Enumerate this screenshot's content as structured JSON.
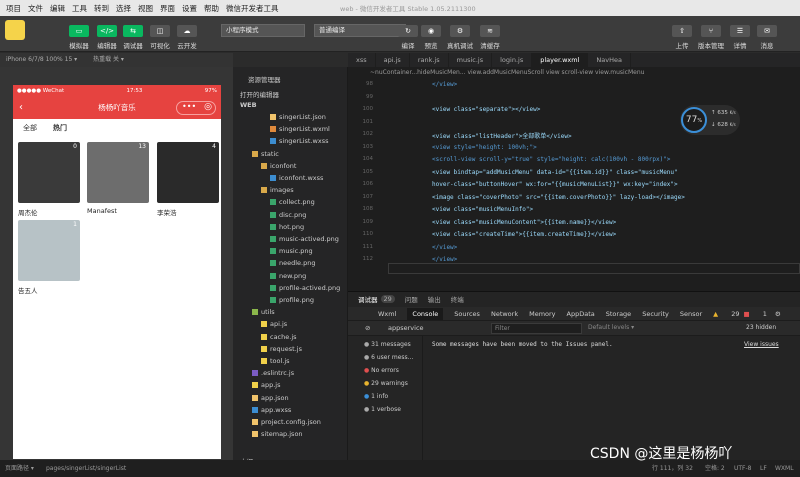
{
  "menu": [
    "项目",
    "文件",
    "编辑",
    "工具",
    "转到",
    "选择",
    "视图",
    "界面",
    "设置",
    "帮助",
    "微信开发者工具"
  ],
  "window_title": "web - 微信开发者工具 Stable 1.05.2111300",
  "toolbar": {
    "left_labels": [
      "模拟器",
      "编辑器",
      "调试器",
      "可视化",
      "云开发"
    ],
    "mode": "小程序模式",
    "compile": "普通编译",
    "mid_labels": [
      "编译",
      "预览",
      "真机调试",
      "清缓存"
    ],
    "right_labels": [
      "上传",
      "版本管理",
      "详情",
      "消息"
    ]
  },
  "sim": {
    "device": "iPhone 6/7/8 100% 15 ▾",
    "hot": "热重载 关 ▾"
  },
  "phone": {
    "carrier": "●●●●● WeChat",
    "time": "17:53",
    "battery": "97%",
    "title": "杨杨吖音乐",
    "tab_all": "全部",
    "tab_hot": "热门"
  },
  "singers": [
    {
      "name": "周杰伦",
      "count": "0"
    },
    {
      "name": "Manafest",
      "count": "13"
    },
    {
      "name": "李荣浩",
      "count": "4"
    },
    {
      "name": "告五人",
      "count": "1"
    }
  ],
  "explorer": {
    "title": "资源管理器",
    "open_editors": "打开的编辑器",
    "root": "WEB",
    "outline": "大纲",
    "items": [
      {
        "label": "singerList.json",
        "indent": 3,
        "color": "#f0c36b"
      },
      {
        "label": "singerList.wxml",
        "indent": 3,
        "color": "#e08a3c"
      },
      {
        "label": "singerList.wxss",
        "indent": 3,
        "color": "#3c8dd0"
      },
      {
        "label": "static",
        "indent": 1,
        "color": "#d9a94a",
        "folder": true
      },
      {
        "label": "iconfont",
        "indent": 2,
        "color": "#d9a94a",
        "folder": true
      },
      {
        "label": "iconfont.wxss",
        "indent": 3,
        "color": "#3c8dd0"
      },
      {
        "label": "images",
        "indent": 2,
        "color": "#d9a94a",
        "folder": true
      },
      {
        "label": "collect.png",
        "indent": 3,
        "color": "#3aa56b"
      },
      {
        "label": "disc.png",
        "indent": 3,
        "color": "#3aa56b"
      },
      {
        "label": "hot.png",
        "indent": 3,
        "color": "#3aa56b"
      },
      {
        "label": "music-actived.png",
        "indent": 3,
        "color": "#3aa56b"
      },
      {
        "label": "music.png",
        "indent": 3,
        "color": "#3aa56b"
      },
      {
        "label": "needle.png",
        "indent": 3,
        "color": "#3aa56b"
      },
      {
        "label": "new.png",
        "indent": 3,
        "color": "#3aa56b"
      },
      {
        "label": "profile-actived.png",
        "indent": 3,
        "color": "#3aa56b"
      },
      {
        "label": "profile.png",
        "indent": 3,
        "color": "#3aa56b"
      },
      {
        "label": "utils",
        "indent": 1,
        "color": "#8bb74b",
        "folder": true
      },
      {
        "label": "api.js",
        "indent": 2,
        "color": "#f0d04a"
      },
      {
        "label": "cache.js",
        "indent": 2,
        "color": "#f0d04a"
      },
      {
        "label": "request.js",
        "indent": 2,
        "color": "#f0d04a"
      },
      {
        "label": "tool.js",
        "indent": 2,
        "color": "#f0d04a"
      },
      {
        "label": ".eslintrc.js",
        "indent": 1,
        "color": "#7b5cc4"
      },
      {
        "label": "app.js",
        "indent": 1,
        "color": "#f0d04a"
      },
      {
        "label": "app.json",
        "indent": 1,
        "color": "#f0c36b"
      },
      {
        "label": "app.wxss",
        "indent": 1,
        "color": "#3c8dd0"
      },
      {
        "label": "project.config.json",
        "indent": 1,
        "color": "#f0c36b"
      },
      {
        "label": "sitemap.json",
        "indent": 1,
        "color": "#f0c36b"
      }
    ]
  },
  "editor_tabs": [
    "xss",
    "api.js",
    "rank.js",
    "music.js",
    "login.js",
    "player.wxml",
    "NavHea"
  ],
  "breadcrumb": "~nuContainer...hideMusicMen...  view.addMusicMenuScroll  view  scroll-view  view.musicMenu",
  "code_lines": [
    {
      "n": "98",
      "text": "</view>"
    },
    {
      "n": "99",
      "text": ""
    },
    {
      "n": "100",
      "text": "<view class=\"separate\"></view>"
    },
    {
      "n": "101",
      "text": ""
    },
    {
      "n": "102",
      "text": "<view class=\"listHeader\">全部歌单</view>"
    },
    {
      "n": "103",
      "text": "<view style=\"height: 100vh;\">"
    },
    {
      "n": "104",
      "text": "  <scroll-view scroll-y=\"true\" style=\"height: calc(100vh - 800rpx)\">"
    },
    {
      "n": "105",
      "text": "    <view bindtap=\"addMusicMenu\" data-id=\"{{item.id}}\" class=\"musicMenu\""
    },
    {
      "n": "106",
      "text": "    hover-class=\"buttonHover\" wx:for=\"{{musicMenuList}}\" wx:key=\"index\">"
    },
    {
      "n": "107",
      "text": "      <image class=\"coverPhoto\" src=\"{{item.coverPhoto}}\" lazy-load></image>"
    },
    {
      "n": "108",
      "text": "      <view class=\"musicMenuInfo\">"
    },
    {
      "n": "109",
      "text": "        <view class=\"musicMenuContent\">{{item.name}}</view>"
    },
    {
      "n": "110",
      "text": "        <view class=\"createTime\">{{item.createTime}}</view>"
    },
    {
      "n": "111",
      "text": "      </view>"
    },
    {
      "n": "112",
      "text": "    </view>"
    }
  ],
  "perf": {
    "value": "77",
    "unit": "%",
    "up": "635",
    "down": "628",
    "rate_unit": "K/s"
  },
  "panel_tabs": [
    "调试器",
    "29",
    "问题",
    "输出",
    "终端"
  ],
  "devtools_tabs": [
    "Wxml",
    "Console",
    "Sources",
    "Network",
    "Memory",
    "AppData",
    "Storage",
    "Security",
    "Sensor"
  ],
  "warn_count": "29",
  "err_count": "1",
  "filter": {
    "context": "appservice",
    "placeholder": "Filter",
    "levels": "Default levels ▾",
    "hidden": "23 hidden"
  },
  "console_side": [
    {
      "label": "31 messages",
      "color": "#aaa"
    },
    {
      "label": "6 user mess...",
      "color": "#aaa"
    },
    {
      "label": "No errors",
      "color": "#e04f4f"
    },
    {
      "label": "29 warnings",
      "color": "#e8b32e"
    },
    {
      "label": "1 info",
      "color": "#3b8fd8"
    },
    {
      "label": "1 verbose",
      "color": "#aaa"
    }
  ],
  "console_msg": "Some messages have been moved to the Issues panel.",
  "view_issues": "View issues",
  "status": {
    "path_label": "页面路径 ▾",
    "path": "pages/singerList/singerList",
    "pos": "行 111，列 32",
    "spaces": "空格: 2",
    "enc": "UTF-8",
    "eol": "LF",
    "lang": "WXML"
  },
  "watermark": "CSDN @这里是杨杨吖"
}
